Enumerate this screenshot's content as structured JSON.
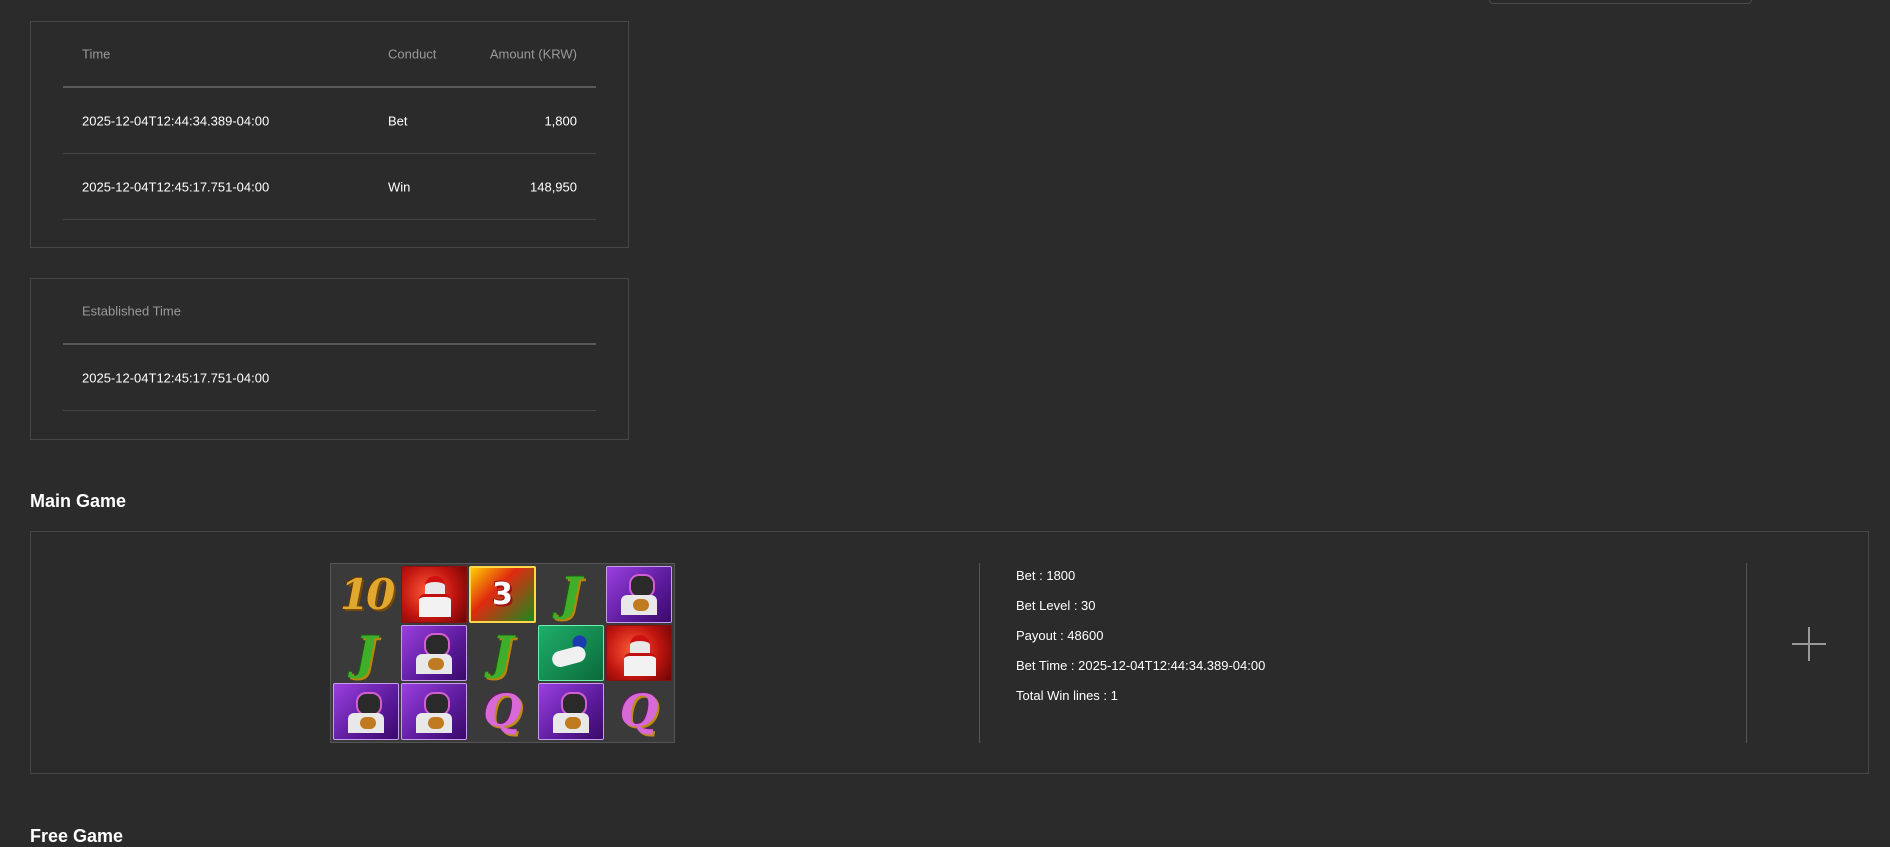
{
  "transactions": {
    "headers": {
      "time": "Time",
      "conduct": "Conduct",
      "amount": "Amount (KRW)"
    },
    "rows": [
      {
        "time": "2025-12-04T12:44:34.389-04:00",
        "conduct": "Bet",
        "amount": "1,800"
      },
      {
        "time": "2025-12-04T12:45:17.751-04:00",
        "conduct": "Win",
        "amount": "148,950"
      }
    ]
  },
  "established": {
    "header": "Established Time",
    "value": "2025-12-04T12:45:17.751-04:00"
  },
  "main_game": {
    "title": "Main Game",
    "reels": [
      [
        "10",
        "red-batter",
        "scatter-3",
        "J",
        "purple-catcher"
      ],
      [
        "J",
        "purple-catcher",
        "J",
        "green-pitcher",
        "red-batter"
      ],
      [
        "purple-catcher",
        "purple-catcher",
        "Q",
        "purple-catcher",
        "Q"
      ]
    ],
    "info": {
      "bet": "Bet : 1800",
      "bet_level": "Bet Level : 30",
      "payout": "Payout : 48600",
      "bet_time": "Bet Time : 2025-12-04T12:44:34.389-04:00",
      "total_win_lines": "Total Win lines : 1"
    },
    "expand_icon": "plus-icon"
  },
  "free_game": {
    "title": "Free Game"
  }
}
